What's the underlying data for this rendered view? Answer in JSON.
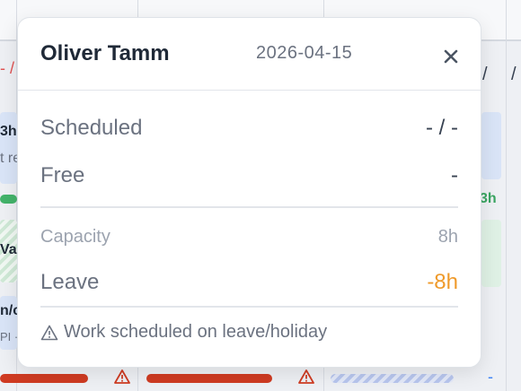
{
  "popover": {
    "name": "Oliver Tamm",
    "date": "2026-04-15",
    "close_icon": "close-icon",
    "rows": {
      "scheduled": {
        "label": "Scheduled",
        "value": "- / -"
      },
      "free": {
        "label": "Free",
        "value": "-"
      },
      "capacity": {
        "label": "Capacity",
        "value": "8h"
      },
      "leave": {
        "label": "Leave",
        "value": "-8h",
        "value_color": "#ef9a2a"
      }
    },
    "warning": {
      "icon": "warning-icon",
      "text": "Work scheduled on leave/holiday"
    }
  },
  "background": {
    "fragments": {
      "hours_a": "3h",
      "task_a": "t re",
      "hours_green": "3h",
      "va": "Va",
      "nc": "n/c",
      "pl": "PI ·",
      "slash_header": "/",
      "dash": "-",
      "red_mark": "- /"
    }
  },
  "colors": {
    "accent_orange": "#ef9a2a",
    "bar_red": "#cf3b22",
    "bar_green": "#43b36a",
    "cell_blue": "#d9e4f7",
    "cell_green": "#dff1e5"
  }
}
